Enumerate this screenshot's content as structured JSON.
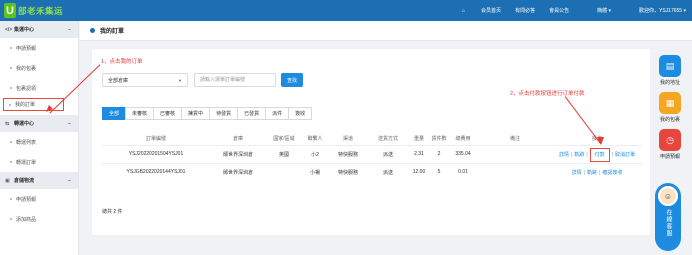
{
  "topbar": {
    "logo_mark": "U",
    "logo_text": "部老禾集运",
    "links": [
      "会员首页",
      "有問必答",
      "會員公告",
      "簡體"
    ],
    "account": "歡迎你，YSJ17655",
    "home_icon": "home-icon",
    "brand_color": "#1d6fb3"
  },
  "sidebar": {
    "groups": [
      {
        "title": "集運中心",
        "icon": "code-icon",
        "items": [
          "申請預報",
          "我的包裹",
          "包裹認領",
          "我的訂單"
        ]
      },
      {
        "title": "轉運中心",
        "icon": "truck-icon",
        "items": [
          "轉運列表",
          "轉運訂單"
        ]
      },
      {
        "title": "倉儲物流",
        "icon": "warehouse-icon",
        "items": [
          "申請預報",
          "添加商品"
        ]
      }
    ],
    "active_item": "我的訂單"
  },
  "breadcrumb": {
    "title": "我的訂單"
  },
  "filters": {
    "warehouse_select": "全部倉庫",
    "search_placeholder": "請輸入運單訂單編號",
    "search_button": "查找"
  },
  "tabs": [
    "全部",
    "未審核",
    "已審核",
    "揀貨中",
    "待發貨",
    "已發貨",
    "派件",
    "簽收"
  ],
  "active_tab": "全部",
  "table": {
    "headers": [
      "訂單編號",
      "倉庫",
      "國家/區域",
      "聯繫人",
      "渠道",
      "送貨方式",
      "重量",
      "貨件數",
      "總費用",
      "備注",
      "操作"
    ],
    "rows": [
      {
        "order_no": "YSJ20220201504YSJ01",
        "warehouse": "鄖世界深圳倉",
        "country": "英國",
        "contact": "小2",
        "channel": "特快服務",
        "delivery": "派送",
        "weight": "2.31",
        "pieces": "2",
        "total": "335.04",
        "remark": "",
        "ops": [
          "詳情",
          "軌跡",
          "付款",
          "取消訂單"
        ]
      },
      {
        "order_no": "YSJGB2022020144YSJ01",
        "warehouse": "鄖世界深圳倉",
        "country": "",
        "contact": "小楊",
        "channel": "特快服務",
        "delivery": "派送",
        "weight": "12.00",
        "pieces": "5",
        "total": "0.01",
        "remark": "",
        "ops": [
          "詳情",
          "軌跡",
          "確認簽收"
        ]
      }
    ]
  },
  "total_text": "總共 2 件",
  "annotations": {
    "step1": "1，点击我的订单",
    "step2": "2，点击付款按钮进行订单付款",
    "color": "#e53935"
  },
  "right_tools": [
    {
      "label": "我的地址",
      "icon": "address-icon",
      "color": "#1d8ce0"
    },
    {
      "label": "我的包裹",
      "icon": "package-icon",
      "color": "#f5a623"
    },
    {
      "label": "申請預報",
      "icon": "clock-icon",
      "color": "#e8453c"
    }
  ],
  "customer_service": "在線客服"
}
